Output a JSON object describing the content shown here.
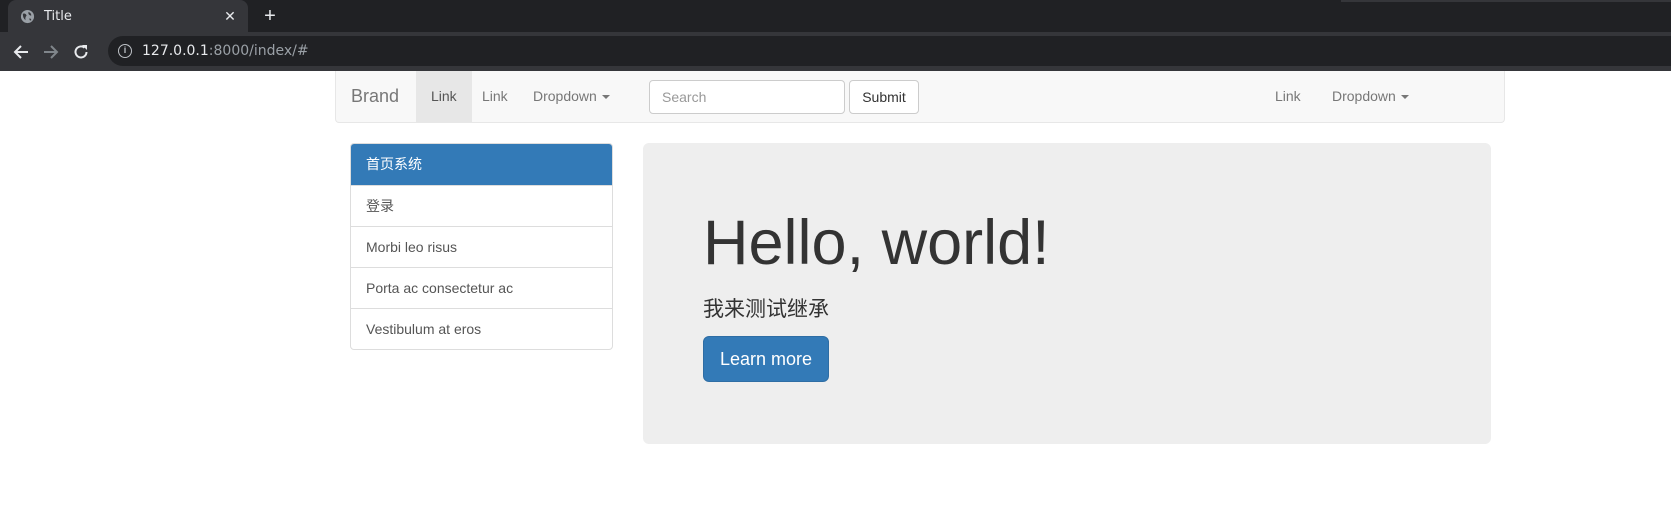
{
  "browser": {
    "tab_title": "Title",
    "tab_close": "✕",
    "new_tab": "+",
    "url_host": "127.0.0.1",
    "url_rest": ":8000/index/#"
  },
  "navbar": {
    "brand": "Brand",
    "left_links": [
      "Link",
      "Link"
    ],
    "dropdown_left": "Dropdown",
    "search_placeholder": "Search",
    "submit": "Submit",
    "right_link": "Link",
    "dropdown_right": "Dropdown"
  },
  "sidebar": {
    "items": [
      "首页系统",
      "登录",
      "Morbi leo risus",
      "Porta ac consectetur ac",
      "Vestibulum at eros"
    ]
  },
  "jumbotron": {
    "title": "Hello, world!",
    "subtitle": "我来测试继承",
    "button": "Learn more"
  },
  "colors": {
    "primary": "#337ab7",
    "navbar_bg": "#f8f8f8",
    "jumbotron_bg": "#eeeeee",
    "chrome_dark": "#202124"
  }
}
